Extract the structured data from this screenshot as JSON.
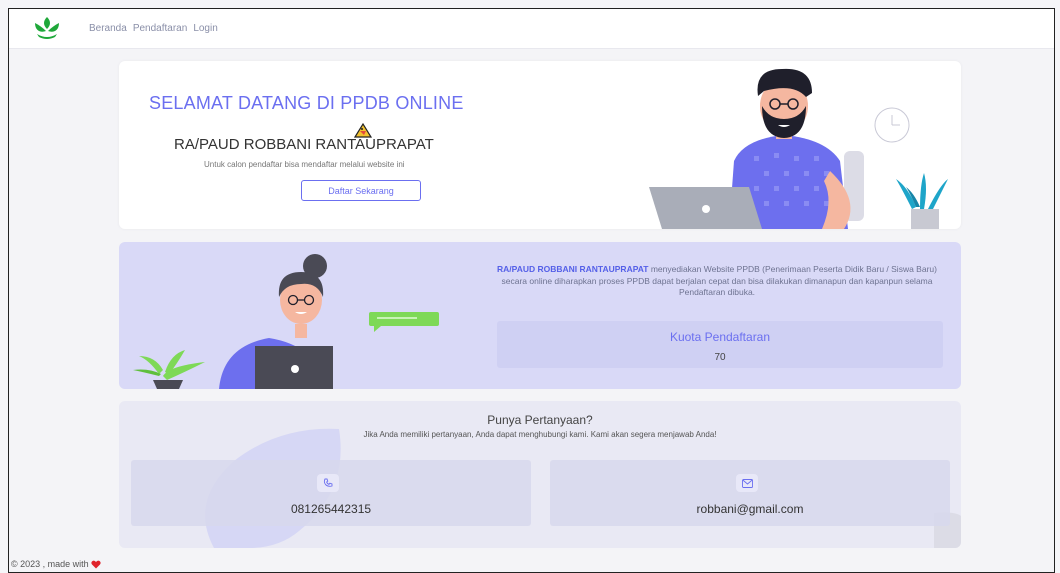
{
  "nav": {
    "links": [
      "Beranda",
      "Pendaftaran",
      "Login"
    ]
  },
  "hero": {
    "title": "SELAMAT DATANG DI PPDB ONLINE",
    "school": "RA/PAUD ROBBANI RANTAUPRAPAT",
    "description": "Untuk calon pendaftar bisa mendaftar melalui website ini",
    "button_label": "Daftar Sekarang"
  },
  "info": {
    "school_name": "RA/PAUD ROBBANI RANTAUPRAPAT",
    "text": " menyediakan Website PPDB (Penerimaan Peserta Didik Baru / Siswa Baru) secara online diharapkan proses PPDB dapat berjalan cepat dan bisa dilakukan dimanapun dan kapanpun selama Pendaftaran dibuka.",
    "quota_label": "Kuota Pendaftaran",
    "quota_value": "70"
  },
  "contact": {
    "title": "Punya Pertanyaan?",
    "description": "Jika Anda memiliki pertanyaan, Anda dapat menghubungi kami. Kami akan segera menjawab Anda!",
    "phone": "081265442315",
    "email": "robbani@gmail.com",
    "phone_icon": "phone-icon",
    "email_icon": "mail-icon"
  },
  "footer": {
    "text": "© 2023 , made with"
  },
  "colors": {
    "accent": "#6b6ff0",
    "info_bg": "#d9d9f7",
    "heart": "#e0242c"
  }
}
